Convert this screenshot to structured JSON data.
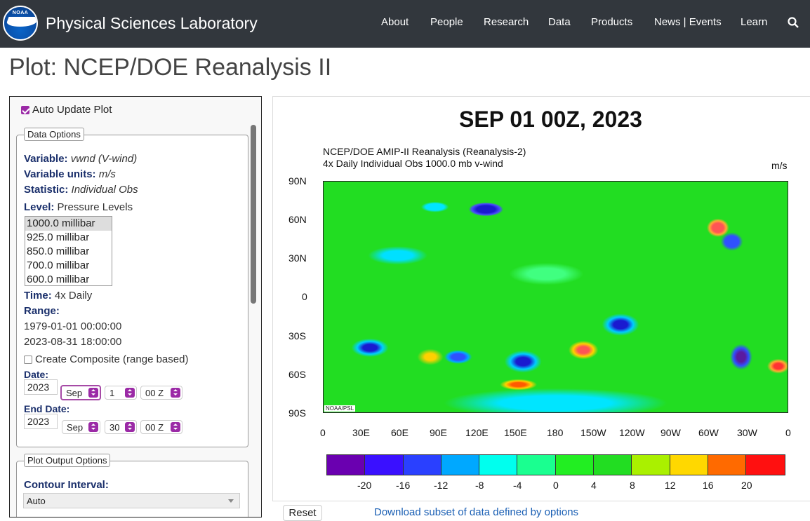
{
  "header": {
    "logo_text": "NOAA",
    "site_title": "Physical Sciences Laboratory",
    "nav": [
      "About",
      "People",
      "Research",
      "Data",
      "Products",
      "News | Events",
      "Learn"
    ],
    "search_icon": "search-icon"
  },
  "page_title": "Plot: NCEP/DOE Reanalysis II",
  "options": {
    "auto_update_label": "Auto Update Plot",
    "auto_update_checked": true,
    "data_options_legend": "Data Options",
    "variable_label": "Variable:",
    "variable_value": "vwnd (V-wind)",
    "units_label": "Variable units:",
    "units_value": "m/s",
    "statistic_label": "Statistic:",
    "statistic_value": "Individual Obs",
    "level_label": "Level:",
    "level_value": "Pressure Levels",
    "levels": [
      "1000.0 millibar",
      "925.0 millibar",
      "850.0 millibar",
      "700.0 millibar",
      "600.0 millibar"
    ],
    "selected_level": "1000.0 millibar",
    "time_label": "Time:",
    "time_value": "4x Daily",
    "range_label": "Range:",
    "range_start": "1979-01-01 00:00:00",
    "range_end": "2023-08-31 18:00:00",
    "composite_label": "Create Composite (range based)",
    "composite_checked": false,
    "date_label": "Date:",
    "date": {
      "year": "2023",
      "month": "Sep",
      "day": "1",
      "hour": "00 Z"
    },
    "end_date_label": "End Date:",
    "end_date": {
      "year": "2023",
      "month": "Sep",
      "day": "30",
      "hour": "00 Z"
    },
    "plot_output_legend": "Plot Output Options",
    "contour_label": "Contour Interval:",
    "contour_value": "Auto"
  },
  "plot": {
    "title": "SEP 01 00Z, 2023",
    "subtitle1": "NCEP/DOE AMIP-II Reanalysis (Reanalysis-2)",
    "subtitle2": "4x Daily Individual Obs 1000.0 mb v-wind",
    "units": "m/s",
    "credit": "NOAA/PSL",
    "lat_labels": [
      "90N",
      "60N",
      "30N",
      "0",
      "30S",
      "60S",
      "90S"
    ],
    "lon_labels": [
      "0",
      "30E",
      "60E",
      "90E",
      "120E",
      "150E",
      "180",
      "150W",
      "120W",
      "90W",
      "60W",
      "30W",
      "0"
    ],
    "colorbar_colors": [
      "#6a00b0",
      "#3a10ff",
      "#2a40ff",
      "#00a8ff",
      "#00ffee",
      "#1aff90",
      "#22ee22",
      "#22dd22",
      "#aaf000",
      "#ffd800",
      "#ff6a00",
      "#ff1010"
    ],
    "colorbar_ticks": [
      "-20",
      "-16",
      "-12",
      "-8",
      "-4",
      "0",
      "4",
      "8",
      "12",
      "16",
      "20"
    ]
  },
  "actions": {
    "reset_label": "Reset",
    "download_label": "Download subset of data defined by options"
  }
}
